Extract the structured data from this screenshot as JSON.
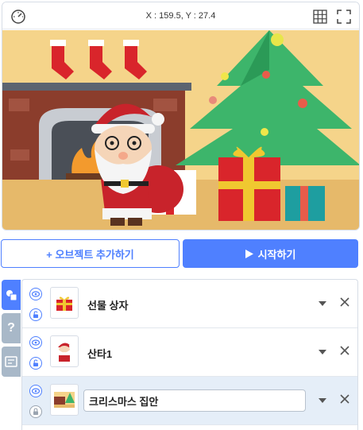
{
  "stage": {
    "coords": "X : 159.5, Y : 27.4"
  },
  "toolbar": {
    "add_object_label": "+ 오브젝트 추가하기",
    "start_label": "시작하기"
  },
  "side_tabs": {
    "help_label": "?"
  },
  "objects": [
    {
      "name": "선물 상자",
      "thumb_icon": "gift-icon",
      "visible": true,
      "locked": false
    },
    {
      "name": "산타1",
      "thumb_icon": "santa-icon",
      "visible": true,
      "locked": false
    },
    {
      "name": "크리스마스 집안",
      "thumb_icon": "room-icon",
      "visible": true,
      "locked": true,
      "editing": true
    }
  ],
  "colors": {
    "accent": "#4f80ff",
    "selected_row": "#e5eef8"
  }
}
